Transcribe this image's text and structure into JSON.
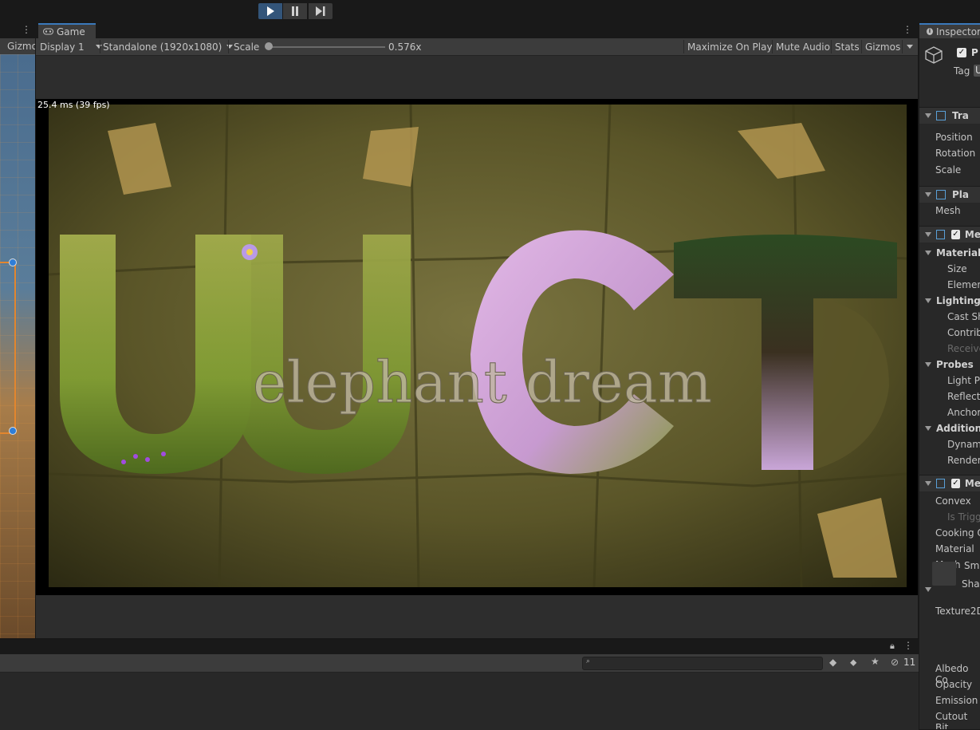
{
  "toolbar": {
    "play_icon": "play-icon",
    "pause_icon": "pause-icon",
    "step_icon": "step-icon",
    "accent_color": "#33557a"
  },
  "scene": {
    "toolbar_label": "Gizmo"
  },
  "game": {
    "tab_label": "Game",
    "display": "Display 1",
    "resolution": "Standalone (1920x1080)",
    "scale_label": "Scale",
    "scale_value": "0.576x",
    "scale_level": 0.0,
    "maximize_on_play": "Maximize On Play",
    "mute_audio": "Mute Audio",
    "stats": "Stats",
    "gizmos": "Gizmos",
    "fps_readout": "25.4 ms (39 fps)",
    "scene_text": "elephant dream"
  },
  "inspector": {
    "tab_label": "Inspector",
    "tag_label": "Tag",
    "tag_value": "U",
    "object_name_fragment": "P",
    "rows": [
      {
        "label": "Tra",
        "kind": "header"
      },
      {
        "label": "Position",
        "kind": "field"
      },
      {
        "label": "Rotation",
        "kind": "field"
      },
      {
        "label": "Scale",
        "kind": "field"
      },
      {
        "label": "Pla",
        "kind": "header"
      },
      {
        "label": "Mesh",
        "kind": "field"
      },
      {
        "label": "Me",
        "kind": "header-check"
      },
      {
        "label": "Materials",
        "kind": "section"
      },
      {
        "label": "Size",
        "kind": "sub"
      },
      {
        "label": "Element",
        "kind": "sub"
      },
      {
        "label": "Lighting",
        "kind": "section"
      },
      {
        "label": "Cast Sh",
        "kind": "sub"
      },
      {
        "label": "Contrib",
        "kind": "sub"
      },
      {
        "label": "Receive",
        "kind": "sub-disabled"
      },
      {
        "label": "Probes",
        "kind": "section"
      },
      {
        "label": "Light Pr",
        "kind": "sub"
      },
      {
        "label": "Reflecti",
        "kind": "sub"
      },
      {
        "label": "Anchor",
        "kind": "sub"
      },
      {
        "label": "Additiona",
        "kind": "section"
      },
      {
        "label": "Dynami",
        "kind": "sub"
      },
      {
        "label": "Renderi",
        "kind": "sub"
      },
      {
        "label": "Me",
        "kind": "header-check"
      },
      {
        "label": "Convex",
        "kind": "field"
      },
      {
        "label": "Is Trigg",
        "kind": "sub-disabled"
      },
      {
        "label": "Cooking O",
        "kind": "field"
      },
      {
        "label": "Material",
        "kind": "field"
      },
      {
        "label": "Mesh",
        "kind": "field"
      }
    ],
    "material_name": "Sm",
    "shader_label": "Sha",
    "texture2d_label": "Texture2D",
    "albedo_label": "Albedo Co",
    "opacity_label": "Opacity",
    "emission_label": "Emission",
    "cutout_label": "Cutout Bit"
  },
  "bottom": {
    "search_placeholder": "",
    "hidden_count": "11"
  }
}
